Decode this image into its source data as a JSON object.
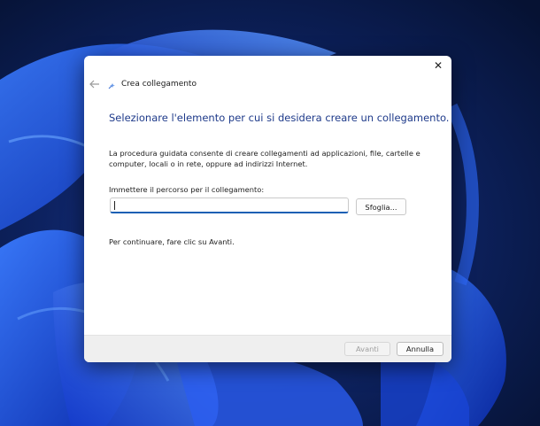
{
  "window": {
    "title": "Crea collegamento",
    "close_glyph": "✕",
    "back_glyph": "←"
  },
  "wizard": {
    "heading": "Selezionare l'elemento per cui si desidera creare un collegamento.",
    "description": "La procedura guidata consente di creare collegamenti ad applicazioni, file, cartelle e computer, locali o in rete, oppure ad indirizzi Internet.",
    "path_label": "Immettere il percorso per il collegamento:",
    "path_value": "",
    "browse_label": "Sfoglia...",
    "continue_hint": "Per continuare, fare clic su Avanti."
  },
  "footer": {
    "next_label": "Avanti",
    "next_enabled": false,
    "cancel_label": "Annulla"
  },
  "icons": {
    "back": "arrow-left-icon",
    "close": "close-icon",
    "wizard": "shortcut-wizard-icon"
  },
  "colors": {
    "heading": "#1e3a8a",
    "input_focus": "#1a5fb4",
    "wallpaper_dark": "#0a1a3f",
    "wallpaper_bloom": "#1f4fe0"
  }
}
